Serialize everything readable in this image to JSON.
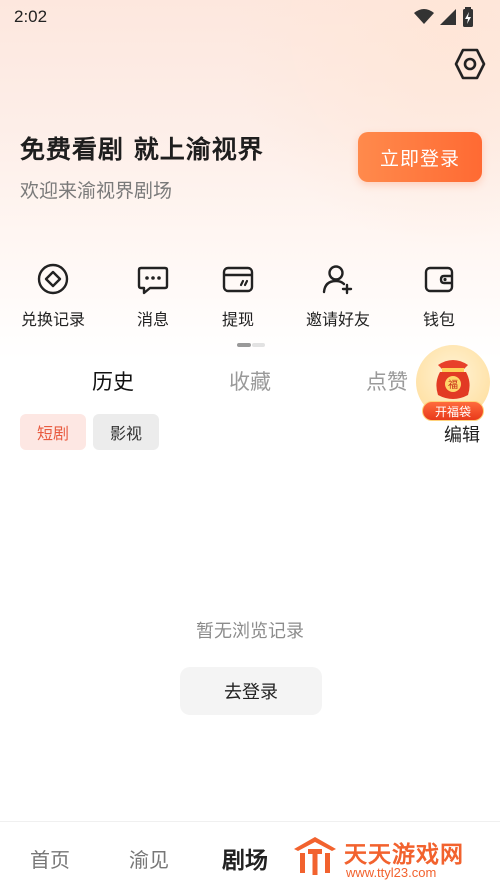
{
  "status_bar": {
    "time": "2:02"
  },
  "hero": {
    "title": "免费看剧 就上渝视界",
    "subtitle": "欢迎来渝视界剧场",
    "login_button": "立即登录"
  },
  "quick_actions": [
    {
      "label": "兑换记录",
      "icon": "exchange-icon"
    },
    {
      "label": "消息",
      "icon": "message-icon"
    },
    {
      "label": "提现",
      "icon": "withdraw-card-icon"
    },
    {
      "label": "邀请好友",
      "icon": "invite-user-icon"
    },
    {
      "label": "钱包",
      "icon": "wallet-icon"
    }
  ],
  "tabs": [
    {
      "label": "历史",
      "active": true
    },
    {
      "label": "收藏",
      "active": false
    },
    {
      "label": "点赞",
      "active": false
    }
  ],
  "lucky_bag": {
    "label": "开福袋",
    "bag_char": "福"
  },
  "filter_chips": [
    {
      "label": "短剧",
      "active": true
    },
    {
      "label": "影视",
      "active": false
    }
  ],
  "edit_label": "编辑",
  "empty_state": {
    "message": "暂无浏览记录",
    "button": "去登录"
  },
  "bottom_nav": [
    {
      "label": "首页",
      "active": false
    },
    {
      "label": "渝见",
      "active": false
    },
    {
      "label": "剧场",
      "active": true
    }
  ],
  "watermark": {
    "title": "天天游戏网",
    "url": "www.ttyl23.com"
  },
  "colors": {
    "accent": "#ff6a33",
    "chip_active_bg": "#fde7e3",
    "chip_active_text": "#e85a3f",
    "watermark": "#f2622e"
  }
}
